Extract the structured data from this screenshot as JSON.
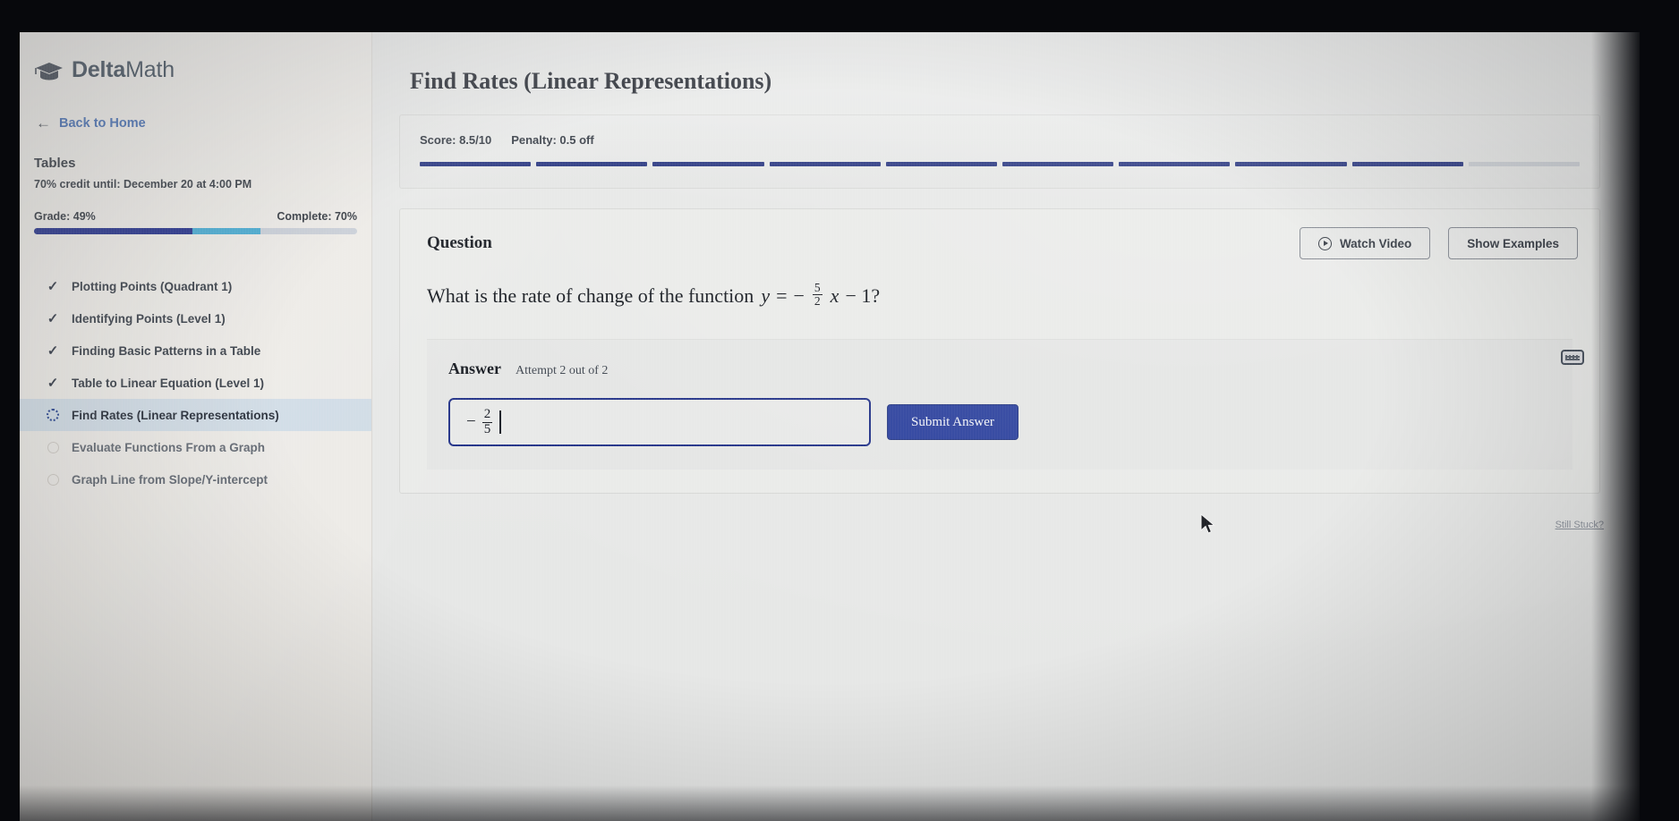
{
  "brand": {
    "name_bold": "Delta",
    "name_light": "Math",
    "logo_icon": "graduation-cap-icon"
  },
  "sidebar": {
    "back_link": "Back to Home",
    "back_arrow_icon": "arrow-left-icon",
    "section_title": "Tables",
    "credit_note": "70% credit until: December 20 at 4:00 PM",
    "grade_label": "Grade: 49%",
    "complete_label": "Complete: 70%",
    "grade_percent": 49,
    "complete_percent": 70,
    "grade_color": "#1d2a86",
    "complete_color": "#41a7cf",
    "track_color": "#c7cdd6",
    "items": [
      {
        "label": "Plotting Points (Quadrant 1)",
        "state": "done",
        "icon": "check-icon"
      },
      {
        "label": "Identifying Points (Level 1)",
        "state": "done",
        "icon": "check-icon"
      },
      {
        "label": "Finding Basic Patterns in a Table",
        "state": "done",
        "icon": "check-icon"
      },
      {
        "label": "Table to Linear Equation (Level 1)",
        "state": "done",
        "icon": "check-icon"
      },
      {
        "label": "Find Rates (Linear Representations)",
        "state": "active",
        "icon": "spinner-icon"
      },
      {
        "label": "Evaluate Functions From a Graph",
        "state": "todo",
        "icon": "circle-empty-icon"
      },
      {
        "label": "Graph Line from Slope/Y-intercept",
        "state": "todo",
        "icon": "circle-empty-icon"
      }
    ]
  },
  "main": {
    "page_title": "Find Rates (Linear Representations)",
    "score": {
      "score_label": "Score: 8.5/10",
      "penalty_label": "Penalty: 0.5 off",
      "segments_total": 10,
      "segments_filled": 9,
      "filled_color": "#1c2a78",
      "empty_color": "#c8ccd2"
    },
    "question": {
      "heading": "Question",
      "text_before": "What is the rate of change of the function",
      "equation": {
        "lhs": "y",
        "equals": "=",
        "minus": "−",
        "frac_num": "5",
        "frac_den": "2",
        "variable": "x",
        "tail": "− 1?"
      }
    },
    "actions": {
      "watch_video": "Watch Video",
      "watch_video_icon": "play-circle-icon",
      "show_examples": "Show Examples"
    },
    "answer": {
      "heading": "Answer",
      "attempt": "Attempt 2 out of 2",
      "input_value_sign": "−",
      "input_value_num": "2",
      "input_value_den": "5",
      "submit_label": "Submit Answer",
      "submit_color": "#2a3f9c",
      "input_border_color": "#1f2f86"
    },
    "still_stuck": "Still Stuck?",
    "keyboard_icon": "keyboard-icon",
    "cursor_icon": "mouse-pointer-icon"
  }
}
